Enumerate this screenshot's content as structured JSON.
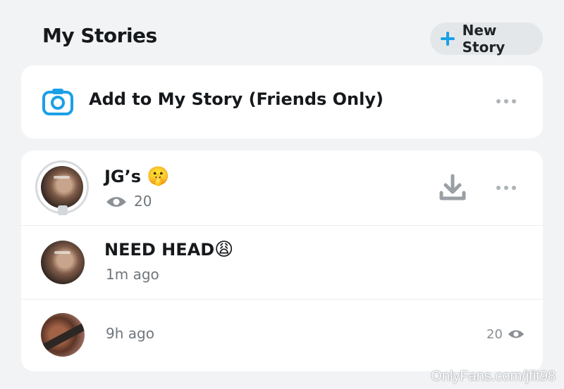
{
  "header": {
    "title": "My Stories",
    "new_story_label": "New Story"
  },
  "add_story": {
    "label": "Add to My Story (Friends Only)"
  },
  "stories": [
    {
      "title": "JG’s",
      "emoji": "🤫",
      "views": "20"
    },
    {
      "title": "NEED HEAD",
      "emoji": "😩",
      "time": "1m ago"
    },
    {
      "time": "9h ago",
      "views": "20"
    }
  ],
  "watermark": "OnlyFans.com/jfit98",
  "colors": {
    "accent": "#1aa0e6",
    "background": "#f1f3f5",
    "card": "#ffffff"
  }
}
